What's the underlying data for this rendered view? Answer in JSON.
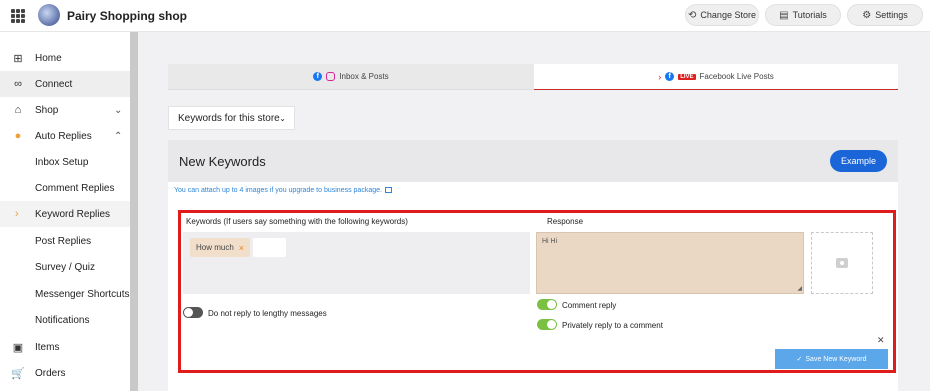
{
  "header": {
    "store_name": "Pairy Shopping shop",
    "buttons": [
      {
        "label": "Change Store",
        "icon": "refresh-icon"
      },
      {
        "label": "Tutorials",
        "icon": "book-icon"
      },
      {
        "label": "Settings",
        "icon": "gear-icon"
      }
    ]
  },
  "sidebar": {
    "items": [
      {
        "label": "Home",
        "icon": "home-icon"
      },
      {
        "label": "Connect",
        "icon": "link-icon"
      },
      {
        "label": "Shop",
        "icon": "shop-icon"
      },
      {
        "label": "Auto Replies",
        "icon": "chat-icon"
      },
      {
        "label": "Inbox Setup"
      },
      {
        "label": "Comment Replies"
      },
      {
        "label": "Keyword Replies"
      },
      {
        "label": "Post Replies"
      },
      {
        "label": "Survey / Quiz"
      },
      {
        "label": "Messenger Shortcuts"
      },
      {
        "label": "Notifications"
      },
      {
        "label": "Items",
        "icon": "box-icon"
      },
      {
        "label": "Orders",
        "icon": "cart-icon"
      }
    ]
  },
  "tabs": [
    {
      "label": "Inbox & Posts"
    },
    {
      "label": "Facebook Live Posts",
      "badge": "LIVE"
    }
  ],
  "keyword_select": {
    "label": "Keywords for this store"
  },
  "card": {
    "title": "New Keywords",
    "example_label": "Example",
    "hint": "You can attach up to 4 images if you upgrade to business package.",
    "keywords_label": "Keywords (If users say something with the following keywords)",
    "response_label": "Response",
    "chip": "How much",
    "response_value": "Hi Hi",
    "toggles": {
      "no_lengthy": "Do not reply to lengthy messages",
      "comment_reply": "Comment reply",
      "private_reply": "Privately reply to a comment"
    },
    "save_label": "Save New Keyword"
  },
  "colors": {
    "accent": "#1a66d9",
    "frame": "#e01b1b",
    "toggle_on": "#7ac143",
    "selected_arrow": "#f0a03a"
  }
}
